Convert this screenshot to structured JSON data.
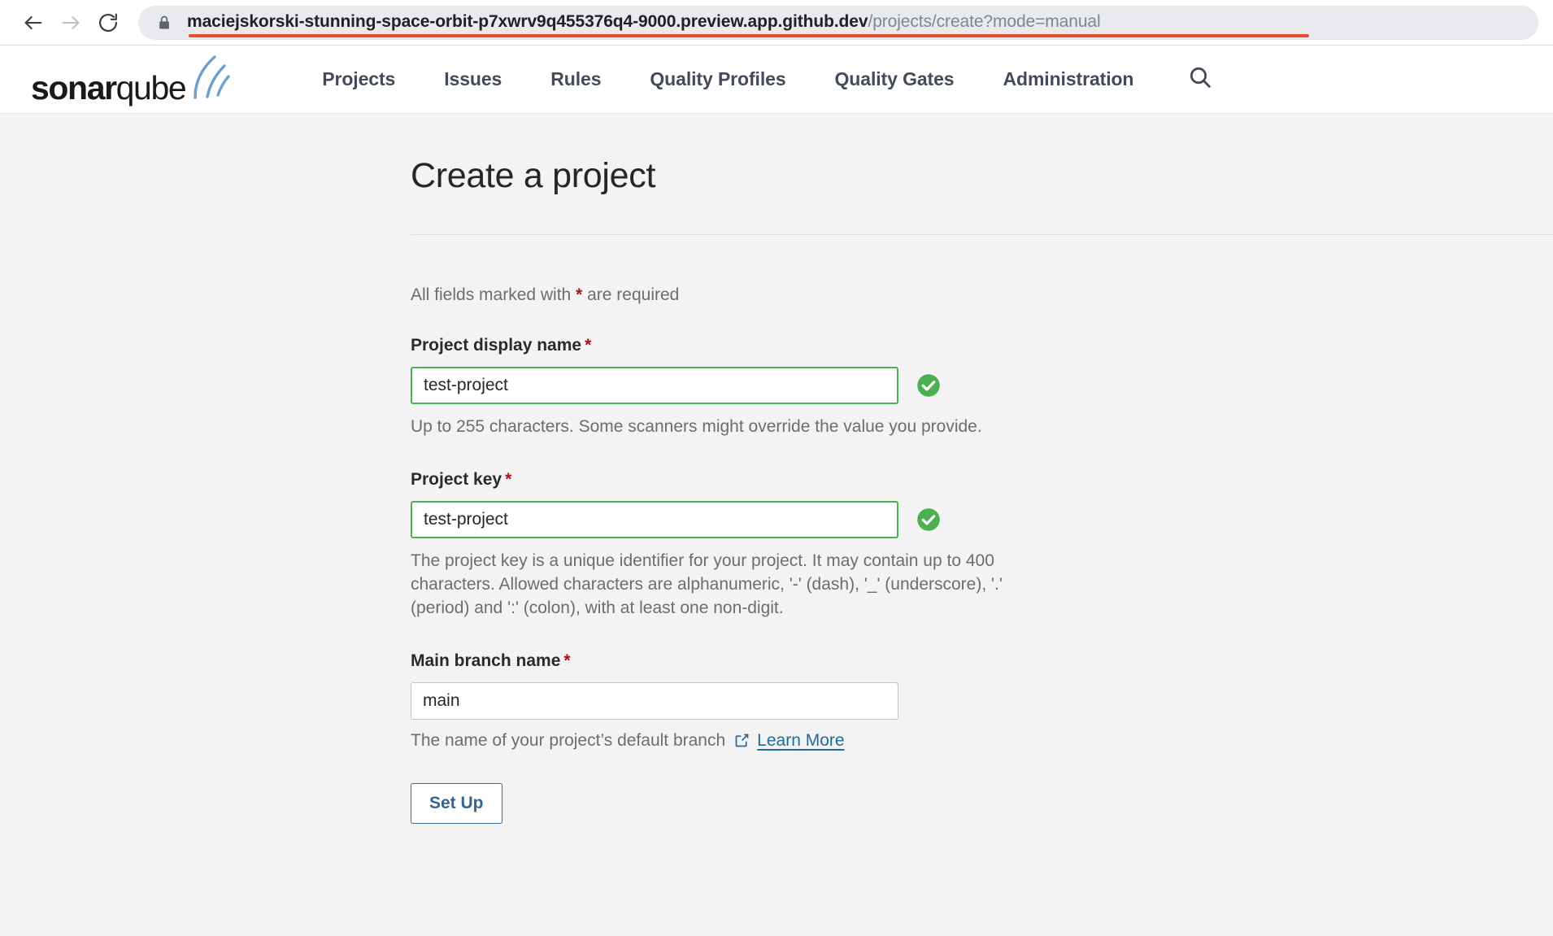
{
  "browser": {
    "back_icon": "arrow-left-icon",
    "forward_icon": "arrow-right-icon",
    "reload_icon": "reload-icon",
    "lock_icon": "lock-icon",
    "url_host": "maciejskorski-stunning-space-orbit-p7xwrv9q455376q4-9000.preview.app.github.dev",
    "url_path": "/projects/create?mode=manual",
    "underline_color": "#ea4b2b"
  },
  "header": {
    "logo_bold": "sonar",
    "logo_light": "qube",
    "nav": [
      {
        "label": "Projects"
      },
      {
        "label": "Issues"
      },
      {
        "label": "Rules"
      },
      {
        "label": "Quality Profiles"
      },
      {
        "label": "Quality Gates"
      },
      {
        "label": "Administration"
      }
    ],
    "search_icon": "search-icon"
  },
  "main": {
    "title": "Create a project",
    "required_note_before": "All fields marked with ",
    "required_star": "*",
    "required_note_after": " are required",
    "fields": [
      {
        "label": "Project display name",
        "required": "*",
        "value": "test-project",
        "valid": true,
        "valid_icon": "check-circle-icon",
        "help": "Up to 255 characters. Some scanners might override the value you provide."
      },
      {
        "label": "Project key",
        "required": "*",
        "value": "test-project",
        "valid": true,
        "valid_icon": "check-circle-icon",
        "help": "The project key is a unique identifier for your project. It may contain up to 400 characters. Allowed characters are alphanumeric, '-' (dash), '_' (underscore), '.' (period) and ':' (colon), with at least one non-digit."
      },
      {
        "label": "Main branch name",
        "required": "*",
        "value": "main",
        "valid": false,
        "help_prefix": "The name of your project’s default branch",
        "help_link": "Learn More",
        "help_link_icon": "external-link-icon"
      }
    ],
    "submit_label": "Set Up"
  },
  "colors": {
    "valid_green": "#43a047",
    "required_red": "#a4161a",
    "link_blue": "#236a97",
    "nav_slate": "#434a59",
    "page_bg": "#f3f3f3"
  }
}
